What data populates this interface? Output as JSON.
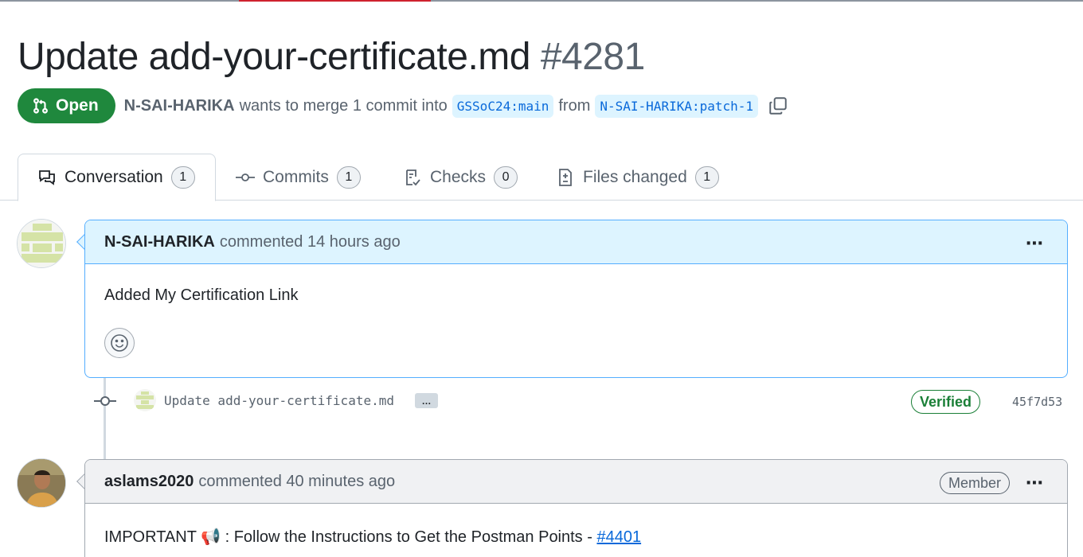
{
  "pr": {
    "title": "Update add-your-certificate.md",
    "number": "#4281",
    "state": "Open",
    "author": "N-SAI-HARIKA",
    "merge_text": "wants to merge 1 commit into",
    "base_branch": "GSSoC24:main",
    "from_text": "from",
    "head_branch": "N-SAI-HARIKA:patch-1"
  },
  "tabs": [
    {
      "label": "Conversation",
      "count": "1",
      "icon": "comment-discussion-icon"
    },
    {
      "label": "Commits",
      "count": "1",
      "icon": "git-commit-icon"
    },
    {
      "label": "Checks",
      "count": "0",
      "icon": "checklist-icon"
    },
    {
      "label": "Files changed",
      "count": "1",
      "icon": "file-diff-icon"
    }
  ],
  "comments": [
    {
      "author": "N-SAI-HARIKA",
      "action": "commented 14 hours ago",
      "body": "Added My Certification Link"
    },
    {
      "author": "aslams2020",
      "action": "commented 40 minutes ago",
      "role": "Member",
      "body_prefix": "IMPORTANT 📢 : Follow the Instructions to Get the Postman Points - ",
      "body_link": "#4401"
    }
  ],
  "commit": {
    "message": "Update add-your-certificate.md",
    "more": "…",
    "verified": "Verified",
    "sha": "45f7d53"
  },
  "colors": {
    "open_green": "#1f883d",
    "link_blue": "#0969da",
    "highlight_border": "#54aeff"
  }
}
